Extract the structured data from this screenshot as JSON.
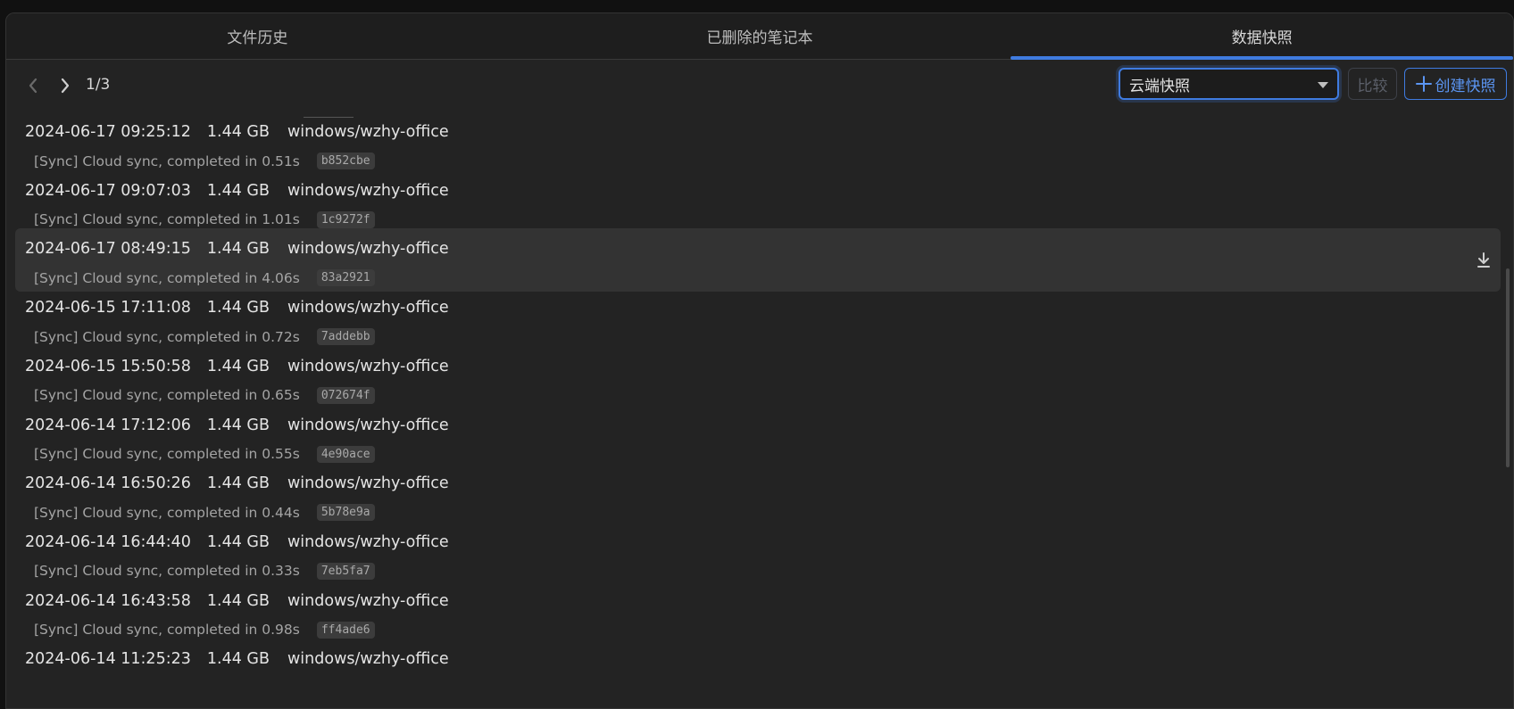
{
  "tabs": [
    {
      "label": "文件历史",
      "active": false
    },
    {
      "label": "已删除的笔记本",
      "active": false
    },
    {
      "label": "数据快照",
      "active": true
    }
  ],
  "toolbar": {
    "page_count": "1/3",
    "select_value": "云端快照",
    "compare_label": "比较",
    "create_label": "创建快照",
    "prev_icon": "chevron-left-icon",
    "next_icon": "chevron-right-icon"
  },
  "colors": {
    "accent": "#3f7be0",
    "background": "#232323",
    "hover_row": "#333333"
  },
  "snapshots": [
    {
      "time": "2024-06-17 09:25:12",
      "size": "1.44 GB",
      "device": "windows/wzhy-office",
      "memo": "[Sync] Cloud sync, completed in 0.51s",
      "hash": "b852cbe"
    },
    {
      "time": "2024-06-17 09:07:03",
      "size": "1.44 GB",
      "device": "windows/wzhy-office",
      "memo": "[Sync] Cloud sync, completed in 1.01s",
      "hash": "1c9272f"
    },
    {
      "time": "2024-06-17 08:49:15",
      "size": "1.44 GB",
      "device": "windows/wzhy-office",
      "memo": "[Sync] Cloud sync, completed in 4.06s",
      "hash": "83a2921"
    },
    {
      "time": "2024-06-15 17:11:08",
      "size": "1.44 GB",
      "device": "windows/wzhy-office",
      "memo": "[Sync] Cloud sync, completed in 0.72s",
      "hash": "7addebb"
    },
    {
      "time": "2024-06-15 15:50:58",
      "size": "1.44 GB",
      "device": "windows/wzhy-office",
      "memo": "[Sync] Cloud sync, completed in 0.65s",
      "hash": "072674f"
    },
    {
      "time": "2024-06-14 17:12:06",
      "size": "1.44 GB",
      "device": "windows/wzhy-office",
      "memo": "[Sync] Cloud sync, completed in 0.55s",
      "hash": "4e90ace"
    },
    {
      "time": "2024-06-14 16:50:26",
      "size": "1.44 GB",
      "device": "windows/wzhy-office",
      "memo": "[Sync] Cloud sync, completed in 0.44s",
      "hash": "5b78e9a"
    },
    {
      "time": "2024-06-14 16:44:40",
      "size": "1.44 GB",
      "device": "windows/wzhy-office",
      "memo": "[Sync] Cloud sync, completed in 0.33s",
      "hash": "7eb5fa7"
    },
    {
      "time": "2024-06-14 16:43:58",
      "size": "1.44 GB",
      "device": "windows/wzhy-office",
      "memo": "[Sync] Cloud sync, completed in 0.98s",
      "hash": "ff4ade6"
    },
    {
      "time": "2024-06-14 11:25:23",
      "size": "1.44 GB",
      "device": "windows/wzhy-office",
      "memo": "",
      "hash": ""
    }
  ],
  "hovered_index": 2,
  "row_action_icon": "download-icon"
}
